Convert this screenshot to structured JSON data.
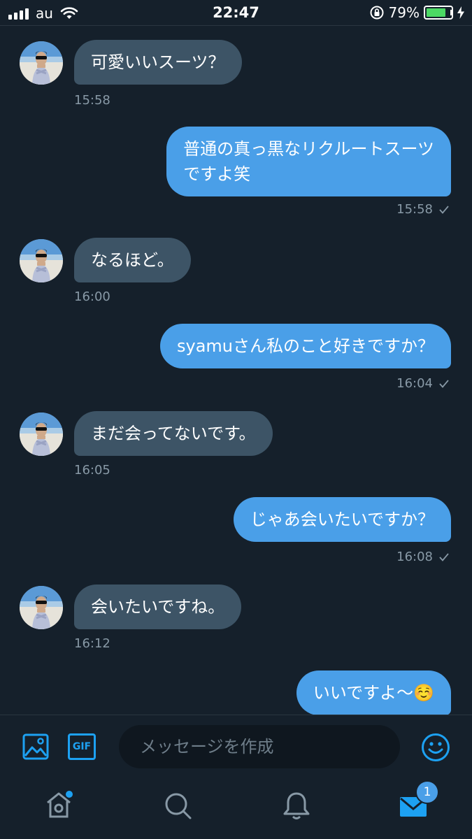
{
  "status_bar": {
    "carrier": "au",
    "time": "22:47",
    "battery_percent": "79%",
    "battery_level": 0.79
  },
  "messages": [
    {
      "direction": "in",
      "text": "可愛いいスーツ？",
      "time": "15:58"
    },
    {
      "direction": "out",
      "lines": [
        "普通の真っ黒なリクルートスーツ",
        "ですよ笑"
      ],
      "time": "15:58",
      "status_icon": "check-icon"
    },
    {
      "direction": "in",
      "text": "なるほど。",
      "time": "16:00"
    },
    {
      "direction": "out",
      "text": "syamuさん私のこと好きですか？",
      "time": "16:04",
      "status_icon": "check-icon"
    },
    {
      "direction": "in",
      "text": "まだ会ってないです。",
      "time": "16:05"
    },
    {
      "direction": "out",
      "text": "じゃあ会いたいですか？",
      "time": "16:08",
      "status_icon": "check-icon"
    },
    {
      "direction": "in",
      "text": "会いたいですね。",
      "time": "16:12"
    },
    {
      "direction": "out",
      "text": "いいですよ〜☺️"
    }
  ],
  "composer": {
    "placeholder": "メッセージを作成",
    "gif_label": "GIF"
  },
  "tab_bar": {
    "items": [
      "home-icon",
      "search-icon",
      "bell-icon",
      "mail-icon"
    ],
    "messages_badge": "1"
  },
  "colors": {
    "background": "#15202b",
    "incoming_bubble": "#3d5466",
    "outgoing_bubble": "#4a9fe8",
    "accent": "#1da1f2",
    "muted_text": "#8899a6"
  }
}
